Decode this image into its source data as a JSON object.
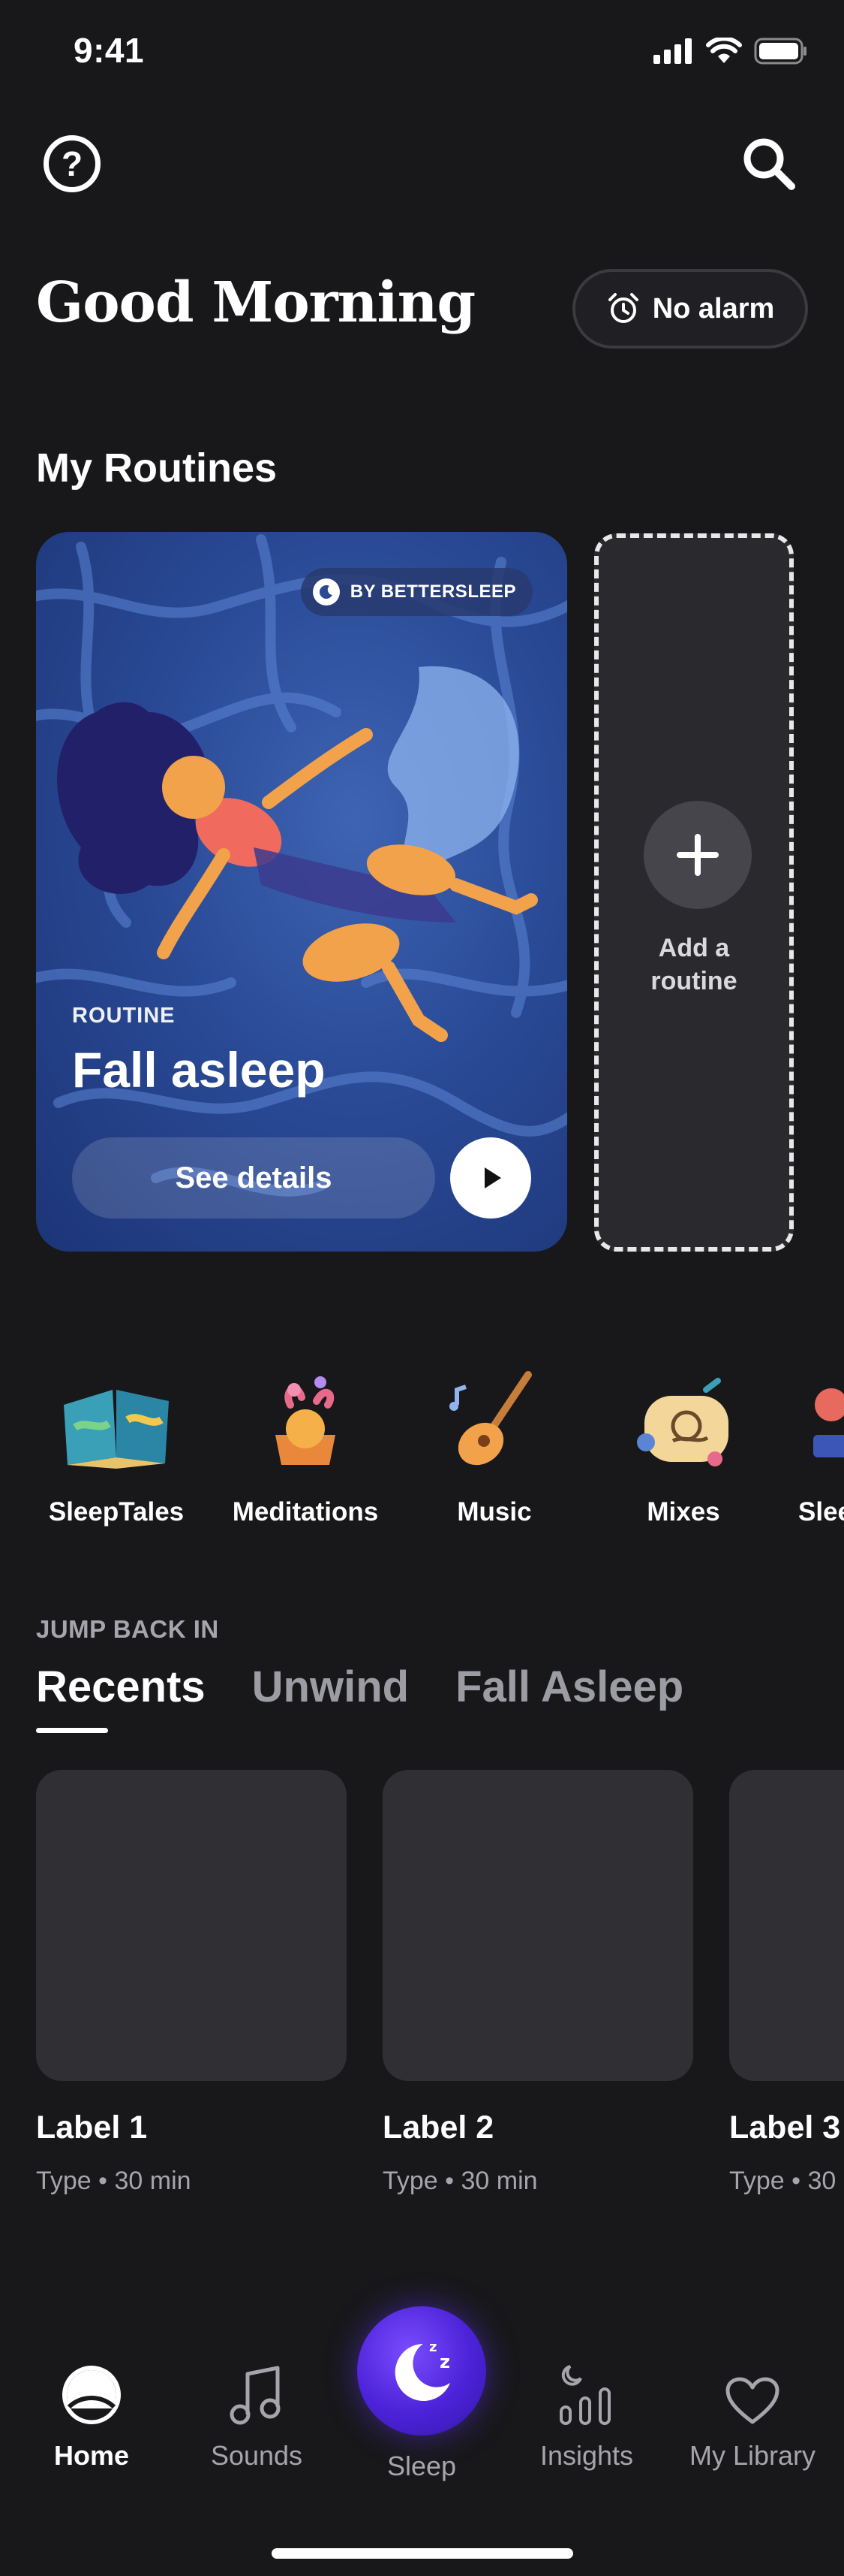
{
  "status_bar": {
    "time": "9:41"
  },
  "header": {
    "greeting": "Good Morning",
    "alarm_label": "No alarm"
  },
  "routines": {
    "section_title": "My Routines",
    "card": {
      "badge": "BY BETTERSLEEP",
      "eyebrow": "ROUTINE",
      "title": "Fall asleep",
      "details_button": "See details"
    },
    "add_label_line1": "Add a",
    "add_label_line2": "routine"
  },
  "categories": [
    {
      "label": "SleepTales",
      "icon": "book-icon"
    },
    {
      "label": "Meditations",
      "icon": "meditation-icon"
    },
    {
      "label": "Music",
      "icon": "guitar-icon"
    },
    {
      "label": "Mixes",
      "icon": "mixes-icon"
    },
    {
      "label": "Slee",
      "icon": "sleep-icon"
    }
  ],
  "jump_back": {
    "eyebrow": "JUMP BACK IN",
    "tabs": [
      "Recents",
      "Unwind",
      "Fall Asleep"
    ],
    "items": [
      {
        "label": "Label 1",
        "meta": "Type • 30 min"
      },
      {
        "label": "Label 2",
        "meta": "Type • 30 min"
      },
      {
        "label": "Label 3",
        "meta": "Type • 30"
      }
    ]
  },
  "nav": {
    "home": "Home",
    "sounds": "Sounds",
    "sleep": "Sleep",
    "insights": "Insights",
    "library": "My Library"
  },
  "colors": {
    "background": "#18181b",
    "accent": "#5b2ff0",
    "card_blue": "#2a4a96"
  }
}
